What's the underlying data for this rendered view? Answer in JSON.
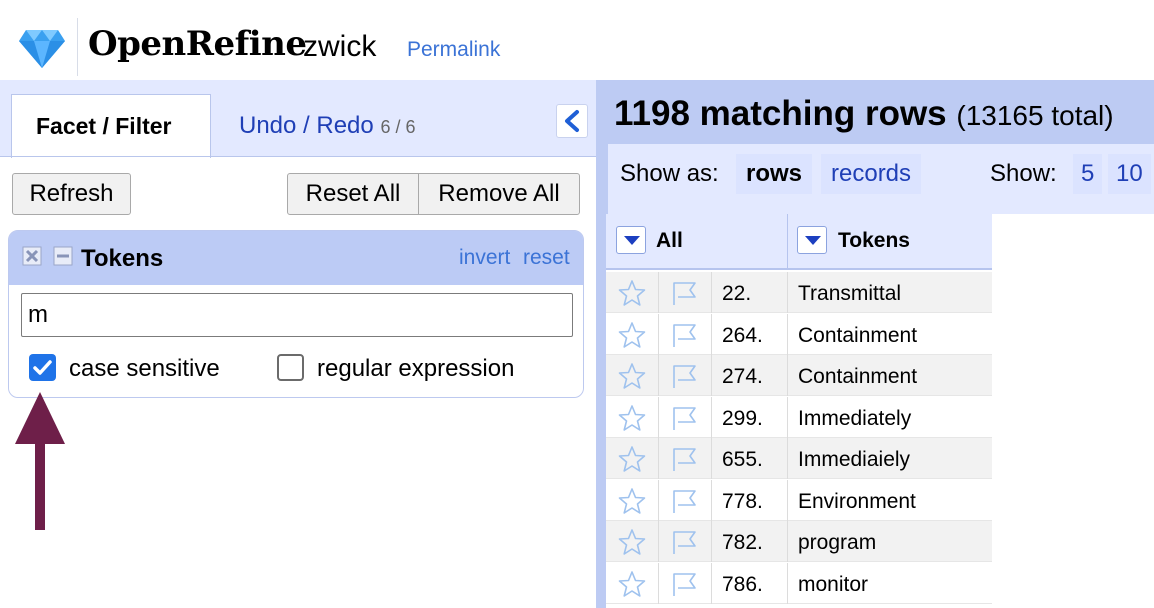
{
  "header": {
    "app_title": "OpenRefine",
    "project_name": "zwick",
    "permalink_label": "Permalink",
    "logo_icon": "diamond-icon"
  },
  "left_panel": {
    "tabs": [
      {
        "label": "Facet / Filter",
        "active": true
      },
      {
        "label": "Undo / Redo",
        "count": "6 / 6",
        "active": false
      }
    ],
    "collapse_icon": "chevron-left-icon",
    "buttons": {
      "refresh": "Refresh",
      "reset_all": "Reset All",
      "remove_all": "Remove All"
    },
    "facet": {
      "title": "Tokens",
      "invert_label": "invert",
      "reset_label": "reset",
      "filter_value": "m",
      "case_sensitive": {
        "label": "case sensitive",
        "checked": true
      },
      "regular_expression": {
        "label": "regular expression",
        "checked": false
      }
    },
    "annotation_color": "#6e1f49"
  },
  "right_panel": {
    "matching_text": "1198 matching rows",
    "total_text": "(13165 total)",
    "show_as_label": "Show as:",
    "modes": {
      "rows": "rows",
      "records": "records"
    },
    "show_label": "Show:",
    "page_sizes": [
      "5",
      "10"
    ],
    "columns": {
      "all": "All",
      "tokens": "Tokens"
    },
    "rows": [
      {
        "num": "22.",
        "token": "Transmittal"
      },
      {
        "num": "264.",
        "token": "Containment"
      },
      {
        "num": "274.",
        "token": "Containment"
      },
      {
        "num": "299.",
        "token": "Immediately"
      },
      {
        "num": "655.",
        "token": "Immediaiely"
      },
      {
        "num": "778.",
        "token": "Environment"
      },
      {
        "num": "782.",
        "token": "program"
      },
      {
        "num": "786.",
        "token": "monitor"
      }
    ]
  },
  "colors": {
    "accent_blue": "#1f3fb6",
    "link_blue": "#3b73d6",
    "panel_blue": "#bdcbf3",
    "checkbox_blue": "#1f73e8"
  }
}
